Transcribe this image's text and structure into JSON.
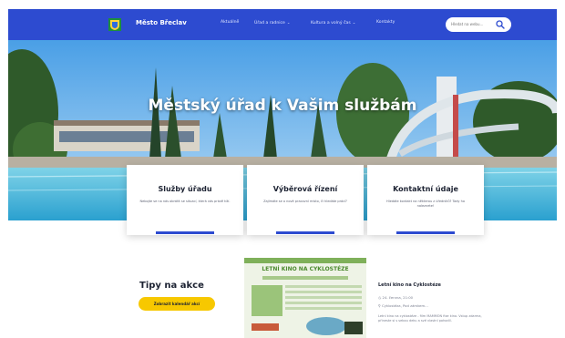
{
  "header": {
    "site_name": "Město Břeclav",
    "menu": [
      "Aktuálně",
      "Úřad a radnice",
      "Kultura a volný čas",
      "Kontakty"
    ],
    "search_placeholder": "Hledat na webu..."
  },
  "hero": {
    "title": "Městský úřad k Vašim službám"
  },
  "cards": [
    {
      "title": "Služby úřadu",
      "text": "Nebojte se na nás obrátit se situací, která vás právě tíží."
    },
    {
      "title": "Výběrová řízení",
      "text": "Zajímáte se o nové pracovní místo, či hledáte práci?"
    },
    {
      "title": "Kontaktní údaje",
      "text": "Hledáte kontakt na některou z úředníků? Tady ho naleznete!"
    }
  ],
  "tips": {
    "heading": "Tipy na akce",
    "button": "Zobrazit kalendář akcí"
  },
  "event": {
    "title": "Letní kino na Cyklostéze",
    "date": "24. června, 21:00",
    "place": "Cyklostéza, Pod zámkem...",
    "description": "Letní kino na cyklostéze - film MAMMON fixe kino. Vstup zdarma, přineste si s sebou deku a své vlastní pohodlí."
  },
  "poster": {
    "title": "LETNÍ KINO NA CYKLOSTÉZE"
  },
  "colors": {
    "nav": "#2d4bd0",
    "button": "#f7c800",
    "accent": "#2d4bd0"
  }
}
